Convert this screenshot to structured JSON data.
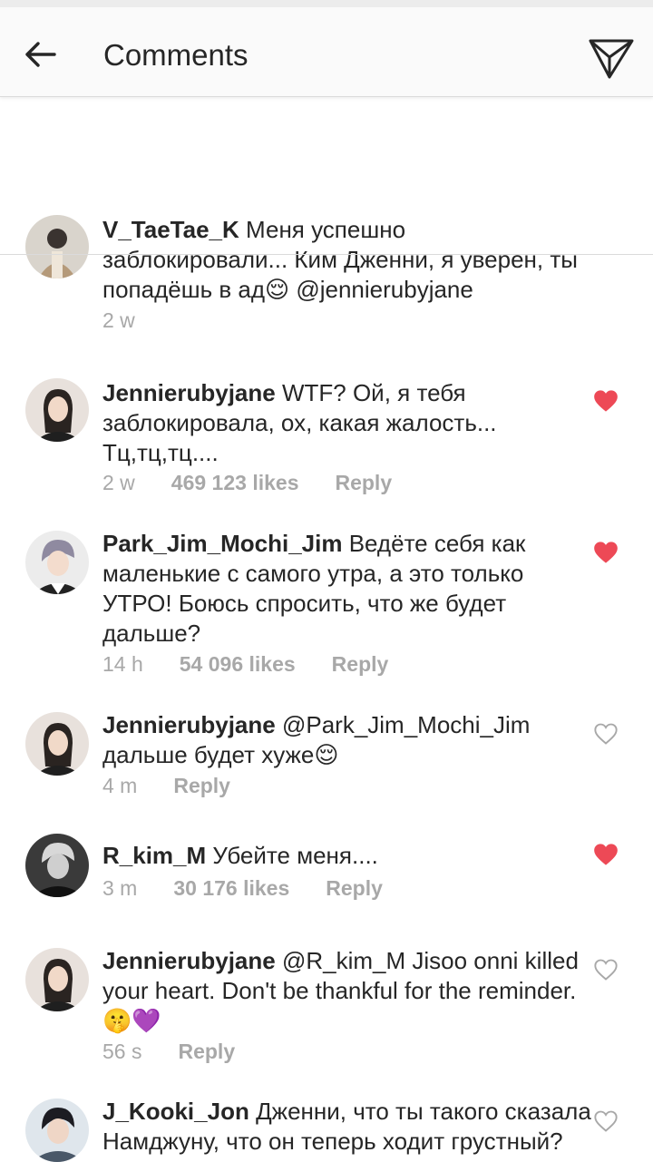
{
  "header": {
    "title": "Comments"
  },
  "caption": {
    "username": "V_TaeTae_K",
    "text": "Меня успешно заблокировали... Ким Дженни, я уверен, ты попадёшь в ад😌 @jennierubyjane",
    "time": "2 w"
  },
  "comments": [
    {
      "username": "Jennierubyjane",
      "text": "WTF? Ой, я тебя заблокировала, ох, какая жалость... Тц,тц,тц....",
      "time": "2 w",
      "likes": "469 123 likes",
      "reply": "Reply",
      "liked": true
    },
    {
      "username": "Park_Jim_Mochi_Jim",
      "text": "Ведёте себя как маленькие с самого утра, а это только УТРО! Боюсь спросить, что же будет дальше?",
      "time": "14 h",
      "likes": "54 096 likes",
      "reply": "Reply",
      "liked": true
    },
    {
      "username": "Jennierubyjane",
      "text": "@Park_Jim_Mochi_Jim дальше будет хуже😌",
      "time": "4 m",
      "likes": "",
      "reply": "Reply",
      "liked": false
    },
    {
      "username": "R_kim_M",
      "text": "Убейте меня....",
      "time": "3 m",
      "likes": "30 176 likes",
      "reply": "Reply",
      "liked": true
    },
    {
      "username": "Jennierubyjane",
      "text": "@R_kim_M Jisoo onni killed your heart. Don't be thankful for the reminder. 🤫💜",
      "time": "56 s",
      "likes": "",
      "reply": "Reply",
      "liked": false
    },
    {
      "username": "J_Kooki_Jon",
      "text": "Дженни, что ты такого сказала Намджуну, что он теперь ходит грустный?",
      "time": "",
      "likes": "",
      "reply": "",
      "liked": false
    }
  ],
  "colors": {
    "heart_liked": "#ed4956",
    "meta": "#a8a8a8",
    "text": "#262626"
  },
  "icons": {
    "back": "arrow-left-icon",
    "send": "paper-plane-icon",
    "liked": "heart-filled-icon",
    "unliked": "heart-outline-icon"
  }
}
